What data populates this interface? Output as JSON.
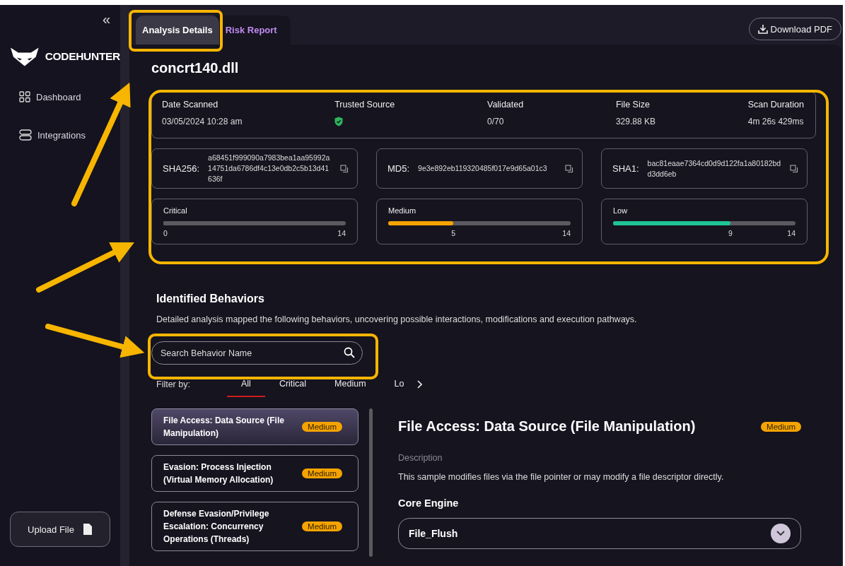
{
  "sidebar": {
    "collapse": "«",
    "brand": "CODEHUNTER",
    "items": [
      {
        "label": "Dashboard",
        "selected": false
      },
      {
        "label": "Integrations",
        "selected": false
      }
    ],
    "upload_button": "Upload File"
  },
  "tabs": [
    {
      "label": "Analysis Details",
      "selected": true
    },
    {
      "label": "Risk Report",
      "selected": false
    }
  ],
  "download_button": "Download PDF",
  "file_name": "concrt140.dll",
  "summary": [
    {
      "label": "Date Scanned",
      "value": "03/05/2024 10:28 am",
      "kind": "text"
    },
    {
      "label": "Trusted Source",
      "kind": "shield"
    },
    {
      "label": "Validated",
      "value": "0/70",
      "kind": "text"
    },
    {
      "label": "File Size",
      "value": "329.88 KB",
      "kind": "text"
    },
    {
      "label": "Scan Duration",
      "value": "4m 26s 429ms",
      "kind": "text"
    }
  ],
  "hashes": [
    {
      "label": "SHA256:",
      "value": "a68451f999090a7983bea1aa95992a14751da6786df4c13e0db2c5b13d41636f"
    },
    {
      "label": "MD5:",
      "value": "9e3e892eb119320485f017e9d65a01c3"
    },
    {
      "label": "SHA1:",
      "value": "bac81eaae7364cd0d9d122fa1a80182bdd3dd6eb"
    }
  ],
  "severities": [
    {
      "label": "Critical",
      "level": 0,
      "reading": "0",
      "max": "14",
      "color": "#5a5a5f"
    },
    {
      "label": "Medium",
      "level": 0.357,
      "reading": "5",
      "max": "14",
      "color": "#f5a300"
    },
    {
      "label": "Low",
      "level": 0.643,
      "reading": "9",
      "max": "14",
      "color": "#1ec495"
    }
  ],
  "behaviors_section": {
    "title": "Identified Behaviors",
    "description": "Detailed analysis mapped the following behaviors, uncovering possible interactions, modifications and execution pathways.",
    "search": {
      "placeholder": "Search Behavior Name"
    },
    "filter_label": "Filter by:",
    "filters": [
      {
        "label": "All",
        "selected": true
      },
      {
        "label": "Critical",
        "selected": false
      },
      {
        "label": "Medium",
        "selected": false
      },
      {
        "label": "Lo",
        "selected": false
      }
    ]
  },
  "behaviors": [
    {
      "name": "File Access: Data Source (File Manipulation)",
      "severity": "Medium",
      "selected": true
    },
    {
      "name": "Evasion: Process Injection (Virtual Memory Allocation)",
      "severity": "Medium",
      "selected": false
    },
    {
      "name": "Defense Evasion/Privilege Escalation: Concurrency Operations (Threads)",
      "severity": "Medium",
      "selected": false
    }
  ],
  "detail": {
    "title": "File Access: Data Source (File Manipulation)",
    "severity": "Medium",
    "description_label": "Description",
    "description": "This sample modifies files via the file pointer or may modify a file descriptor directly.",
    "engine_label": "Core Engine",
    "engine_item": {
      "label": "File_Flush",
      "expanded": false
    }
  }
}
